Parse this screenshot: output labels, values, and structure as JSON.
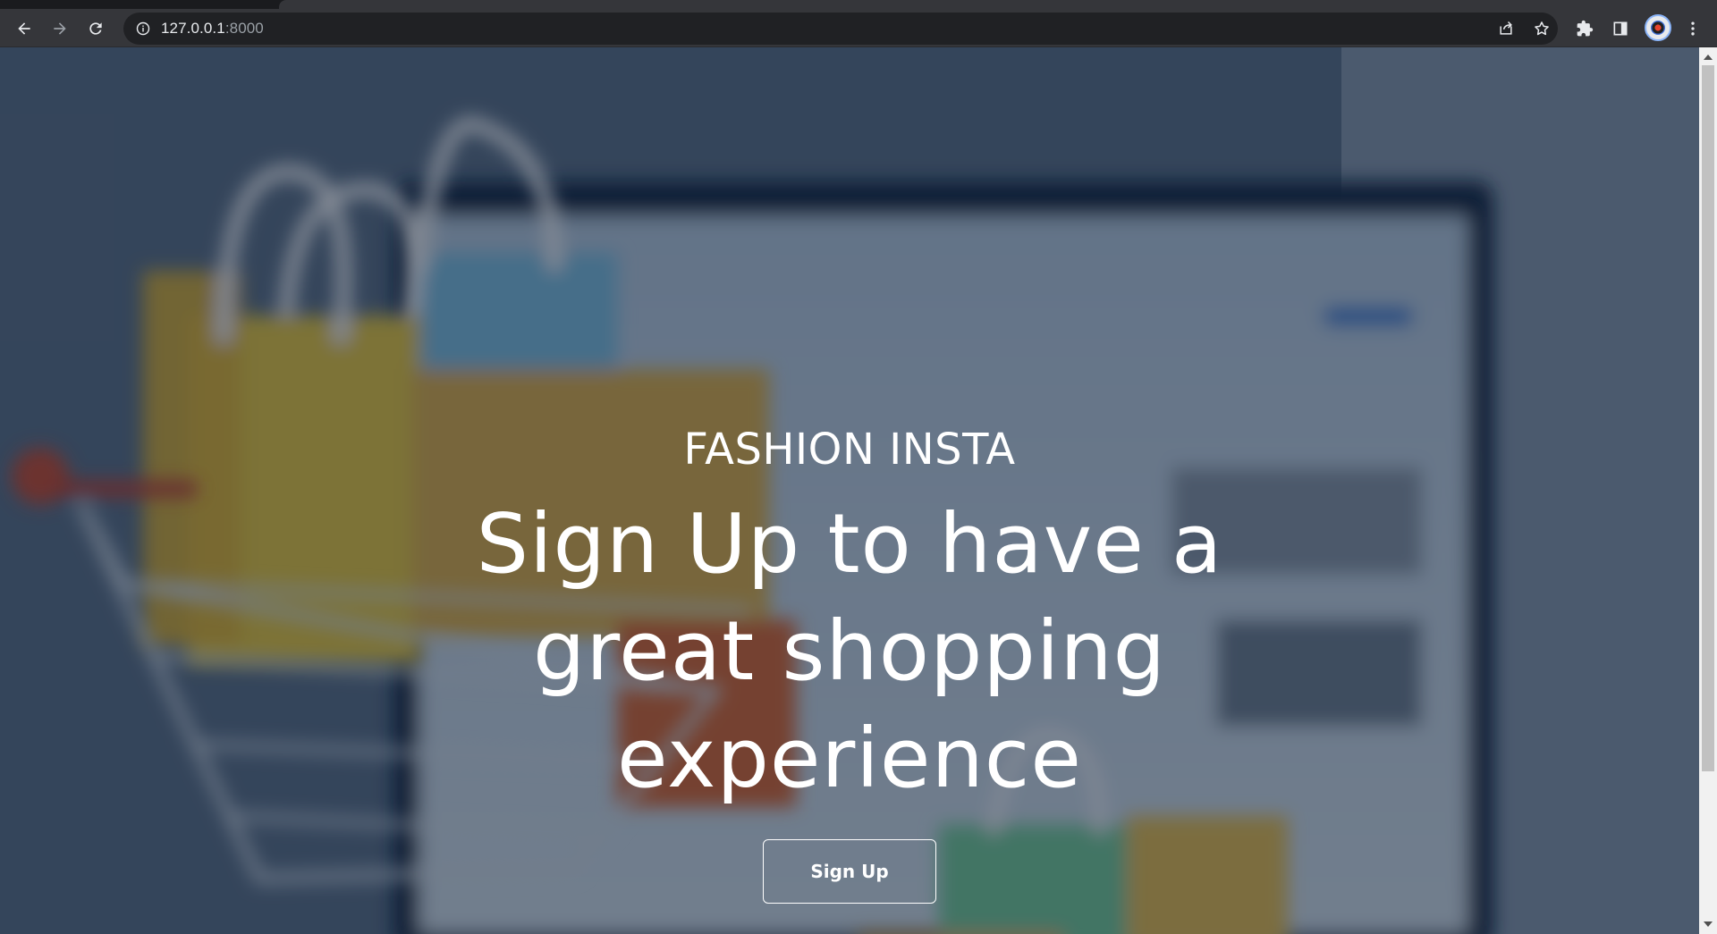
{
  "browser": {
    "url_host": "127.0.0.1",
    "url_port": ":8000",
    "nav": {
      "back_icon": "arrow-left-icon",
      "forward_icon": "arrow-right-icon",
      "reload_icon": "reload-icon"
    },
    "omnibox_actions": [
      "share-icon",
      "bookmark-star-icon"
    ],
    "extensions": [
      "extensions-puzzle-icon",
      "side-panel-icon"
    ],
    "menu_icon": "kebab-menu-icon"
  },
  "hero": {
    "brand": "FASHION INSTA",
    "headline": "Sign Up to have a great shopping experience",
    "cta_label": "Sign Up"
  },
  "colors": {
    "chrome_bg": "#35363a",
    "omnibox_bg": "#202124",
    "overlay": "#121e34",
    "text": "#ffffff"
  }
}
